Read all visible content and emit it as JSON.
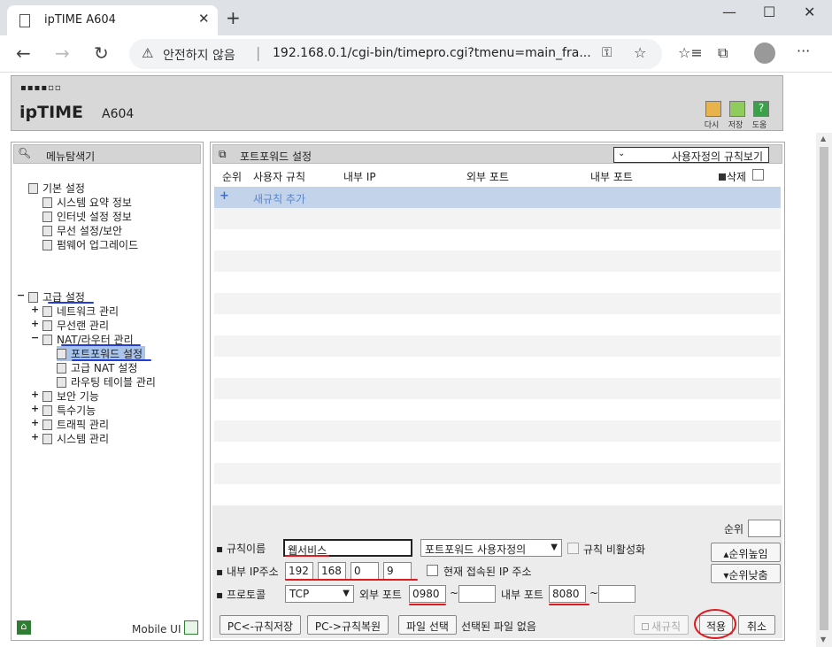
{
  "browser": {
    "tab_title": "ipTIME A604",
    "insecure_label": "안전하지 않음",
    "url": "192.168.0.1/cgi-bin/timepro.cgi?tmenu=main_fra..."
  },
  "header": {
    "logo": "ipTIME",
    "model": "A604",
    "buttons": [
      {
        "label": "다시",
        "color": "#d8a030"
      },
      {
        "label": "저장",
        "color": "#7cc04a"
      },
      {
        "label": "도움",
        "color": "#3aa04a"
      }
    ]
  },
  "sidebar": {
    "title": "메뉴탐색기",
    "basic": {
      "label": "기본 설정",
      "items": [
        "시스템 요약 정보",
        "인터넷 설정 정보",
        "무선 설정/보안",
        "펌웨어 업그레이드"
      ]
    },
    "advanced": {
      "label": "고급 설정",
      "items": [
        "네트워크 관리",
        "무선랜 관리",
        "NAT/라우터 관리"
      ],
      "nat_children": [
        "포트포워드 설정",
        "고급 NAT 설정",
        "라우팅 테이블 관리"
      ],
      "more": [
        "보안 기능",
        "특수기능",
        "트래픽 관리",
        "시스템 관리"
      ]
    },
    "mobile_label": "Mobile UI"
  },
  "main": {
    "title": "포트포워드 설정",
    "view_select": "사용자정의 규칙보기",
    "columns": [
      "순위",
      "사용자 규칙",
      "내부 IP",
      "외부 포트",
      "내부 포트",
      "삭제"
    ],
    "add_rule": "새규칙 추가"
  },
  "form": {
    "rule_name_label": "규칙이름",
    "rule_name_value": "웹서비스",
    "rule_type": "포트포워드 사용자정의",
    "disable_label": "규칙 비활성화",
    "ip_label": "내부 IP주소",
    "ip": [
      "192",
      "168",
      "0",
      "9"
    ],
    "current_ip_label": "현재 접속된 IP 주소",
    "protocol_label": "프로토콜",
    "protocol": "TCP",
    "ext_port_label": "외부 포트",
    "ext_port_from": "0980",
    "ext_port_to": "",
    "int_port_label": "내부 포트",
    "int_port_from": "8080",
    "int_port_to": "",
    "tilde": "~",
    "priority_label": "순위",
    "priority_up": "순위높임",
    "priority_down": "순위낮춤",
    "btn_save_rules": "PC<-규칙저장",
    "btn_restore_rules": "PC->규칙복원",
    "btn_file": "파일 선택",
    "file_status": "선택된 파일 없음",
    "btn_new_rule": "새규칙",
    "btn_apply": "적용",
    "btn_cancel": "취소"
  }
}
